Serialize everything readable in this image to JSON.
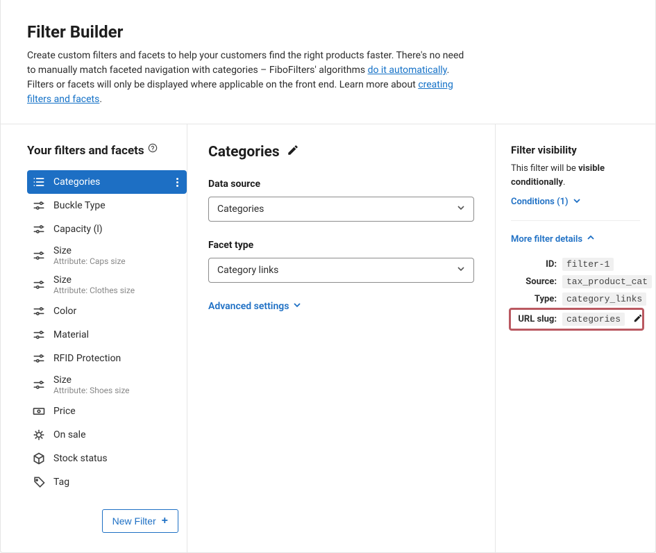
{
  "header": {
    "title": "Filter Builder",
    "intro_1": "Create custom filters and facets to help your customers find the right products faster. There's no need to manually match faceted navigation with categories – FiboFilters' algorithms ",
    "link_auto": "do it automatically",
    "intro_2": ". Filters or facets will only be displayed where applicable on the front end. Learn more about ",
    "link_learn": "creating filters and facets",
    "intro_3": "."
  },
  "sidebar": {
    "title": "Your filters and facets",
    "items": [
      {
        "label": "Categories",
        "sub": "",
        "icon": "list"
      },
      {
        "label": "Buckle Type",
        "sub": "",
        "icon": "sliders"
      },
      {
        "label": "Capacity (l)",
        "sub": "",
        "icon": "sliders"
      },
      {
        "label": "Size",
        "sub": "Attribute: Caps size",
        "icon": "sliders"
      },
      {
        "label": "Size",
        "sub": "Attribute: Clothes size",
        "icon": "sliders"
      },
      {
        "label": "Color",
        "sub": "",
        "icon": "sliders"
      },
      {
        "label": "Material",
        "sub": "",
        "icon": "sliders"
      },
      {
        "label": "RFID Protection",
        "sub": "",
        "icon": "sliders"
      },
      {
        "label": "Size",
        "sub": "Attribute: Shoes size",
        "icon": "sliders"
      },
      {
        "label": "Price",
        "sub": "",
        "icon": "price"
      },
      {
        "label": "On sale",
        "sub": "",
        "icon": "sale"
      },
      {
        "label": "Stock status",
        "sub": "",
        "icon": "box"
      },
      {
        "label": "Tag",
        "sub": "",
        "icon": "tag"
      }
    ],
    "new_filter": "New Filter"
  },
  "main": {
    "title": "Categories",
    "data_source_label": "Data source",
    "data_source_value": "Categories",
    "facet_type_label": "Facet type",
    "facet_type_value": "Category links",
    "advanced": "Advanced settings"
  },
  "right": {
    "vis_title": "Filter visibility",
    "vis_text_1": "This filter will be ",
    "vis_text_b": "visible conditionally",
    "vis_text_2": ".",
    "conditions": "Conditions (1)",
    "details": "More filter details",
    "rows": {
      "id_k": "ID:",
      "id_v": "filter-1",
      "source_k": "Source:",
      "source_v": "tax_product_cat",
      "type_k": "Type:",
      "type_v": "category_links",
      "slug_k": "URL slug:",
      "slug_v": "categories"
    }
  }
}
